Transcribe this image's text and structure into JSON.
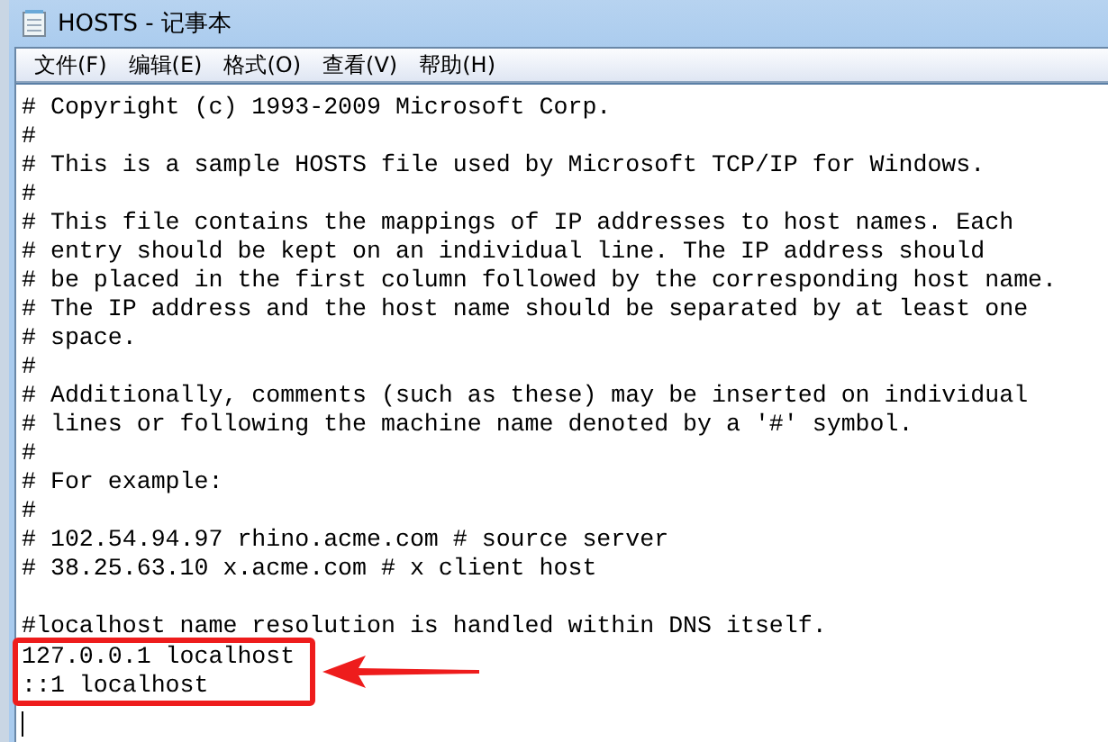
{
  "window": {
    "title": "HOSTS - 记事本"
  },
  "menu": [
    {
      "label": "文件(F)"
    },
    {
      "label": "编辑(E)"
    },
    {
      "label": "格式(O)"
    },
    {
      "label": "查看(V)"
    },
    {
      "label": "帮助(H)"
    }
  ],
  "lines": [
    {
      "kind": "text",
      "text": "# Copyright (c) 1993-2009 Microsoft Corp.",
      "highlighted": false
    },
    {
      "kind": "text",
      "text": "#",
      "highlighted": false
    },
    {
      "kind": "text",
      "text": "# This is a sample HOSTS file used by Microsoft TCP/IP for Windows.",
      "highlighted": false
    },
    {
      "kind": "text",
      "text": "#",
      "highlighted": false
    },
    {
      "kind": "text",
      "text": "# This file contains the mappings of IP addresses to host names. Each",
      "highlighted": false
    },
    {
      "kind": "text",
      "text": "# entry should be kept on an individual line. The IP address should",
      "highlighted": false
    },
    {
      "kind": "text",
      "text": "# be placed in the first column followed by the corresponding host name.",
      "highlighted": false
    },
    {
      "kind": "text",
      "text": "# The IP address and the host name should be separated by at least one",
      "highlighted": false
    },
    {
      "kind": "text",
      "text": "# space.",
      "highlighted": false
    },
    {
      "kind": "text",
      "text": "#",
      "highlighted": false
    },
    {
      "kind": "text",
      "text": "# Additionally, comments (such as these) may be inserted on individual",
      "highlighted": false
    },
    {
      "kind": "text",
      "text": "# lines or following the machine name denoted by a '#' symbol.",
      "highlighted": false
    },
    {
      "kind": "text",
      "text": "#",
      "highlighted": false
    },
    {
      "kind": "text",
      "text": "# For example:",
      "highlighted": false
    },
    {
      "kind": "text",
      "text": "#",
      "highlighted": false
    },
    {
      "kind": "text",
      "text": "# 102.54.94.97 rhino.acme.com # source server",
      "highlighted": false
    },
    {
      "kind": "text",
      "text": "# 38.25.63.10 x.acme.com # x client host",
      "highlighted": false
    },
    {
      "kind": "blank"
    },
    {
      "kind": "text",
      "text": "#localhost name resolution is handled within DNS itself.",
      "highlighted": false
    },
    {
      "kind": "text",
      "text": "127.0.0.1 localhost",
      "highlighted": true
    },
    {
      "kind": "text",
      "text": "::1 localhost",
      "highlighted": true
    }
  ]
}
